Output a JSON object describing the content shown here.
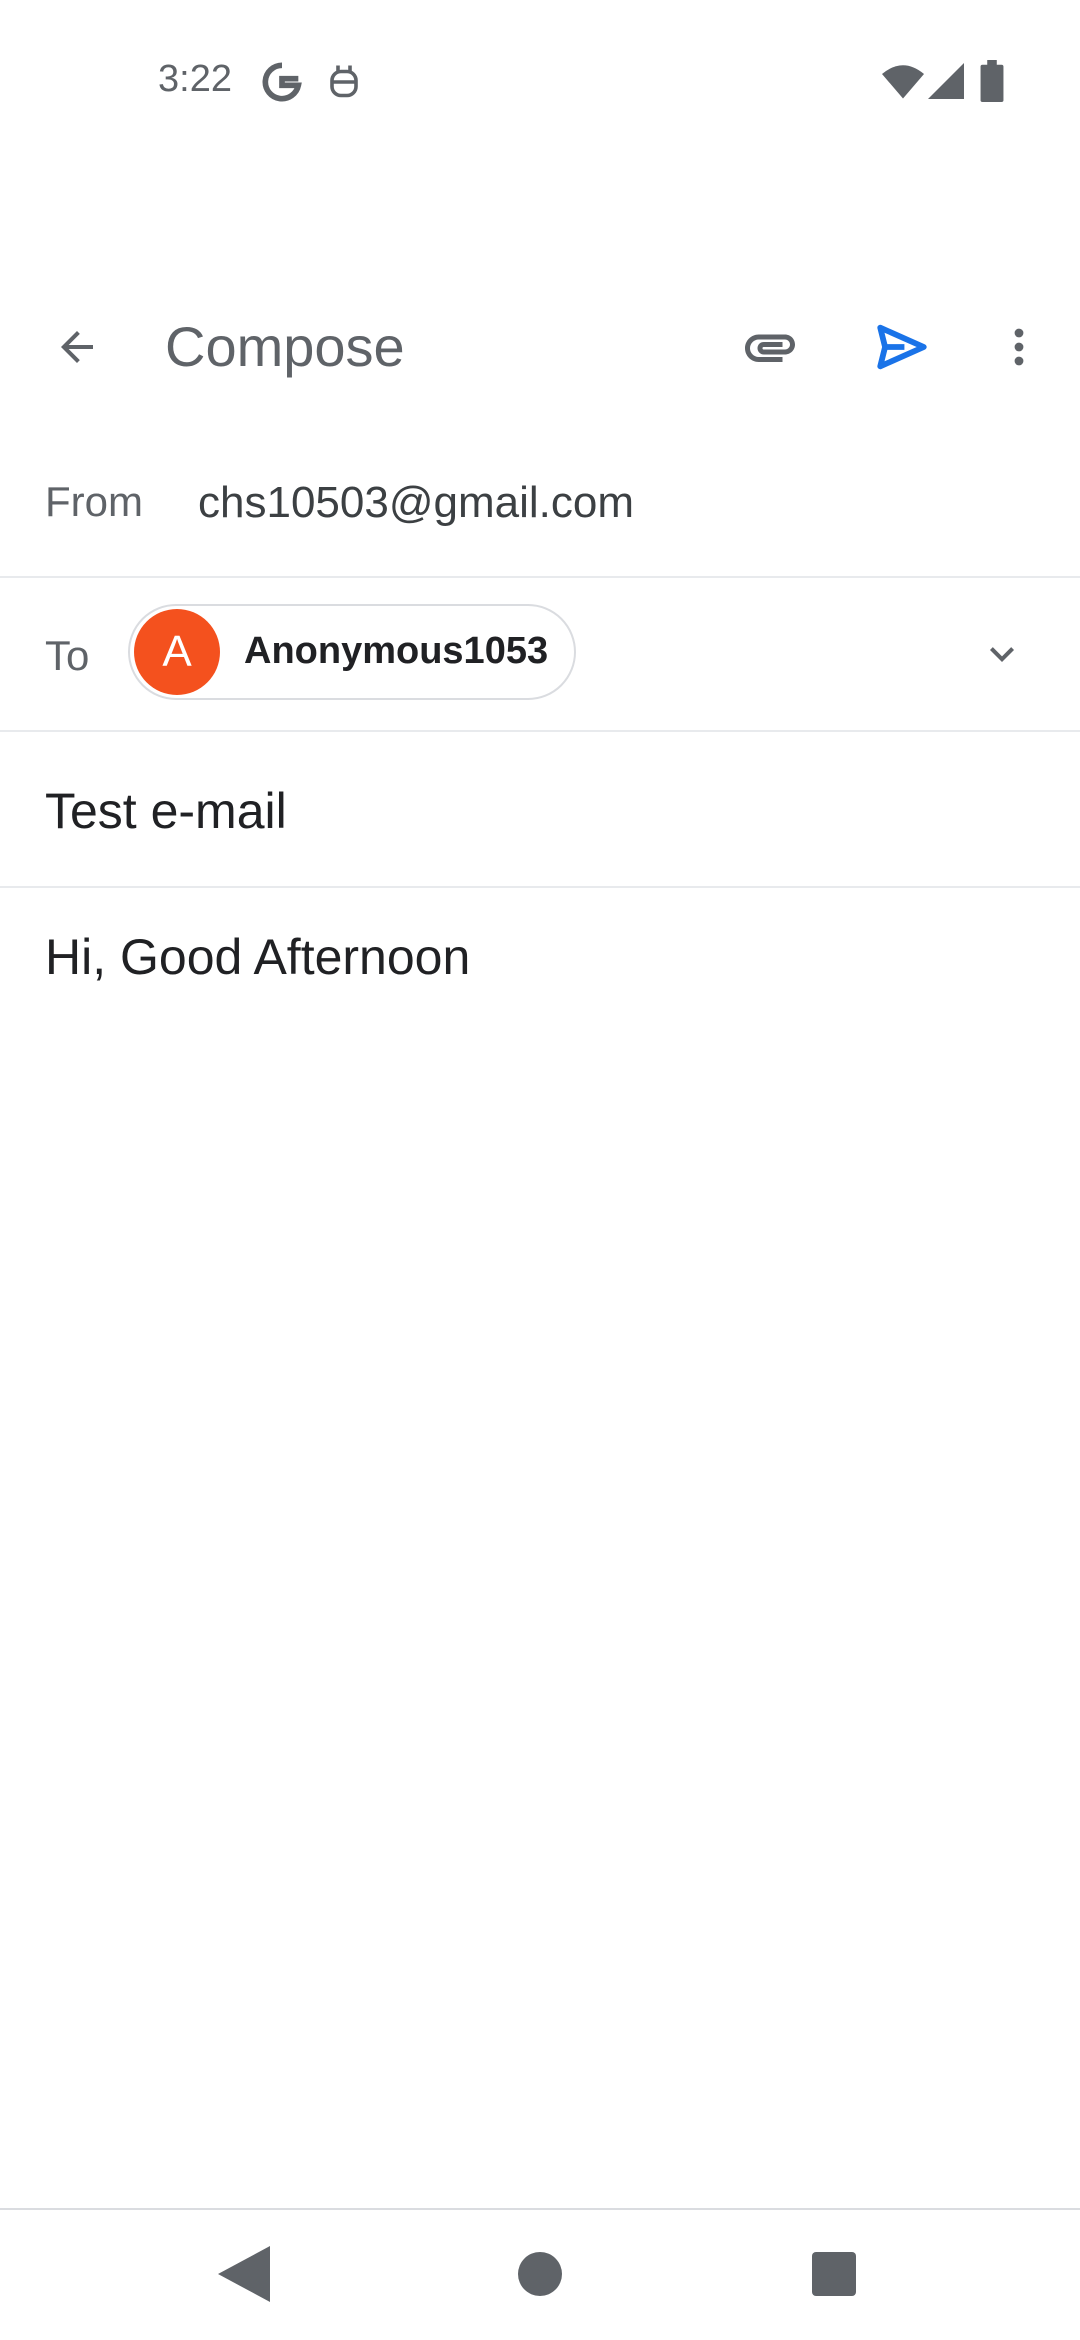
{
  "status_bar": {
    "time": "3:22",
    "icons": [
      "google-g-icon",
      "robot-icon",
      "wifi-icon",
      "cell-signal-icon",
      "battery-icon"
    ]
  },
  "app_bar": {
    "title": "Compose",
    "actions": [
      "back-arrow-icon",
      "attachment-icon",
      "send-icon",
      "more-vert-icon"
    ],
    "send_color": "#1a73e8"
  },
  "compose": {
    "from_label": "From",
    "from_value": "chs10503@gmail.com",
    "to_label": "To",
    "recipient": {
      "initial": "A",
      "name": "Anonymous1053",
      "avatar_color": "#f4511e"
    },
    "subject": "Test e-mail",
    "body": "Hi, Good Afternoon"
  },
  "nav_bar": {
    "buttons": [
      "nav-back-icon",
      "nav-home-icon",
      "nav-recents-icon"
    ]
  }
}
